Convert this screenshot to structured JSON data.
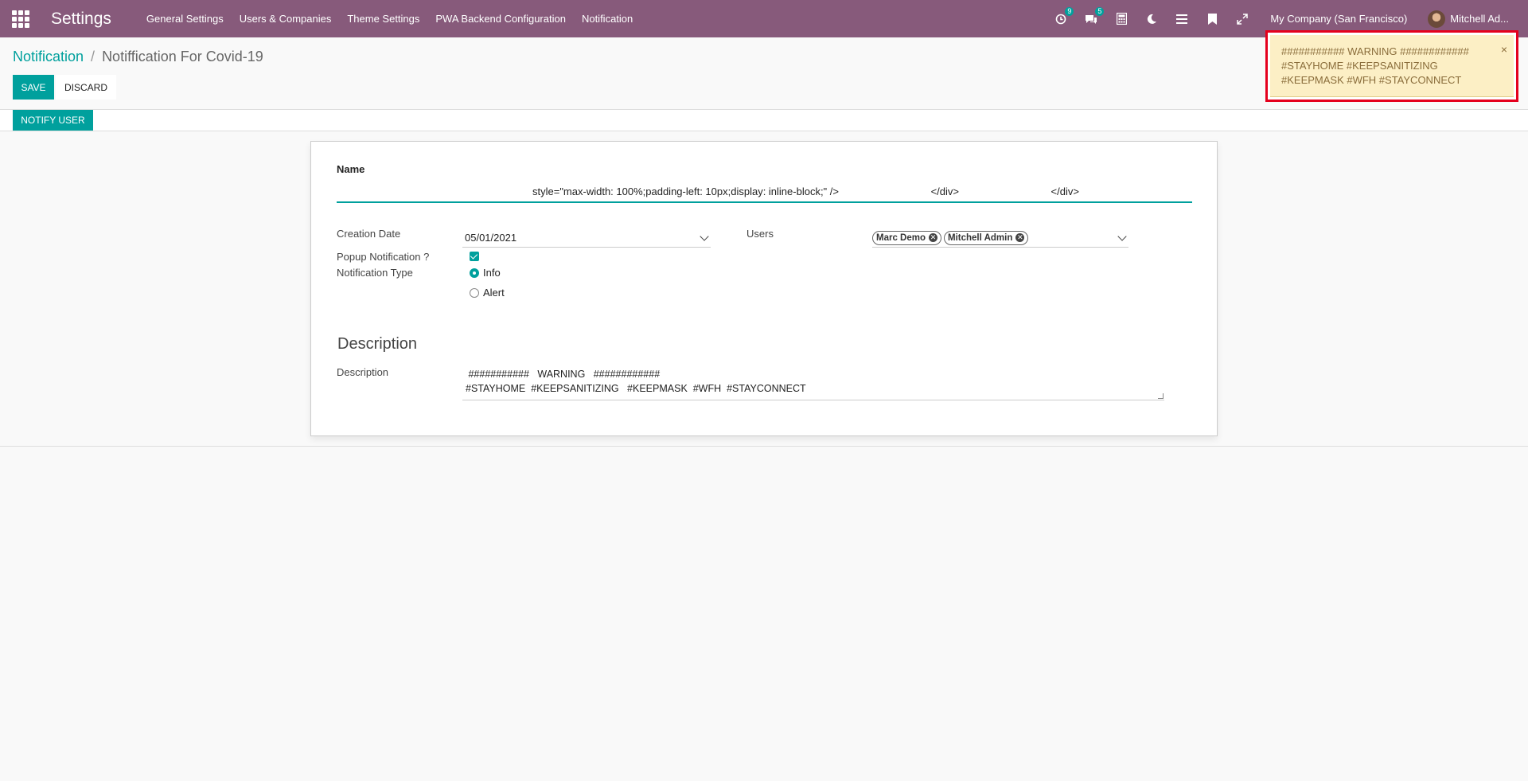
{
  "app": {
    "title": "Settings"
  },
  "menu": [
    "General Settings",
    "Users & Companies",
    "Theme Settings",
    "PWA Backend Configuration",
    "Notification"
  ],
  "systray": {
    "activity_count": "9",
    "messages_count": "5",
    "company": "My Company (San Francisco)",
    "user": "Mitchell Ad..."
  },
  "breadcrumb": {
    "parent": "Notification",
    "separator": "/",
    "current": "Notiffication For Covid-19"
  },
  "buttons": {
    "save": "SAVE",
    "discard": "DISCARD",
    "notify_user": "NOTIFY USER"
  },
  "form": {
    "name_label": "Name",
    "name_value": "style=\"max-width: 100%;padding-left: 10px;display: inline-block;\" />                                </div>                                </div>",
    "creation_date_label": "Creation Date",
    "creation_date_value": "05/01/2021",
    "users_label": "Users",
    "users": [
      "Marc Demo",
      "Mitchell Admin"
    ],
    "popup_label": "Popup Notification ?",
    "popup_checked": true,
    "type_label": "Notification Type",
    "type_options": [
      "Info",
      "Alert"
    ],
    "type_selected": "Info",
    "section_title": "Description",
    "description_label": "Description",
    "description_line1": " ###########   WARNING   ############",
    "description_line2": "#STAYHOME  #KEEPSANITIZING   #KEEPMASK  #WFH  #STAYCONNECT"
  },
  "toast": {
    "line1": "########### WARNING ############",
    "line2": "#STAYHOME #KEEPSANITIZING",
    "line3": "#KEEPMASK #WFH #STAYCONNECT",
    "close": "×"
  },
  "colors": {
    "navbar": "#875a7b",
    "primary": "#00a09d",
    "toast_bg": "#fcefc5",
    "highlight_border": "#e5001d"
  }
}
